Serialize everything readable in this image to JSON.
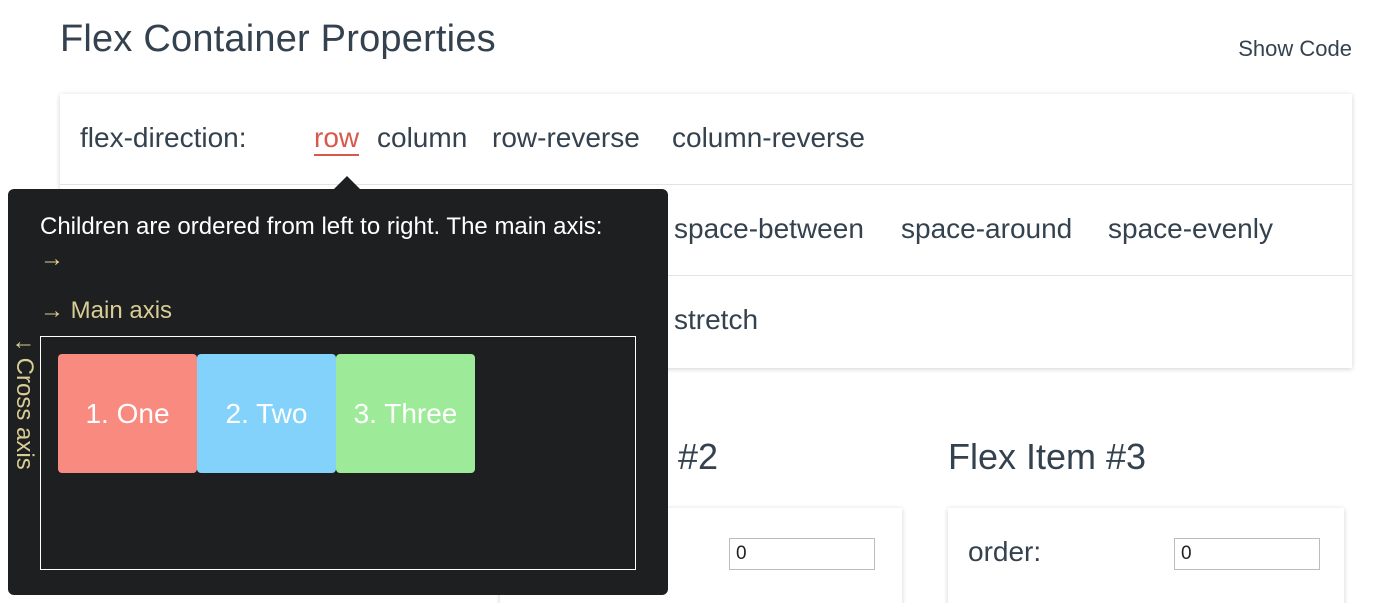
{
  "section": {
    "title": "Flex Container Properties",
    "show_code_label": "Show Code"
  },
  "properties": [
    {
      "label": "flex-direction:",
      "options": [
        "row",
        "column",
        "row-reverse",
        "column-reverse"
      ],
      "selected": "row"
    },
    {
      "label": "",
      "options": [
        "space-between",
        "space-around",
        "space-evenly"
      ]
    },
    {
      "label": "",
      "options": [
        "stretch"
      ]
    }
  ],
  "tooltip": {
    "description": "Children are ordered from left to right. The main axis:",
    "description_arrow": "→",
    "main_axis_label": "→ Main axis",
    "cross_axis_label": "↓ Cross axis",
    "demo_items": [
      {
        "label": "1. One",
        "color": "#f98a80"
      },
      {
        "label": "2. Two",
        "color": "#82d2fb"
      },
      {
        "label": "3. Three",
        "color": "#9deb98"
      }
    ]
  },
  "flex_items": [
    {
      "heading": "#2",
      "order_value": "0"
    },
    {
      "heading": "Flex Item #3",
      "order_label": "order:",
      "order_value": "0"
    }
  ],
  "colors": {
    "accent": "#d8584c",
    "tooltip_bg": "#1e1f20",
    "axis_label": "#d9cd95"
  }
}
